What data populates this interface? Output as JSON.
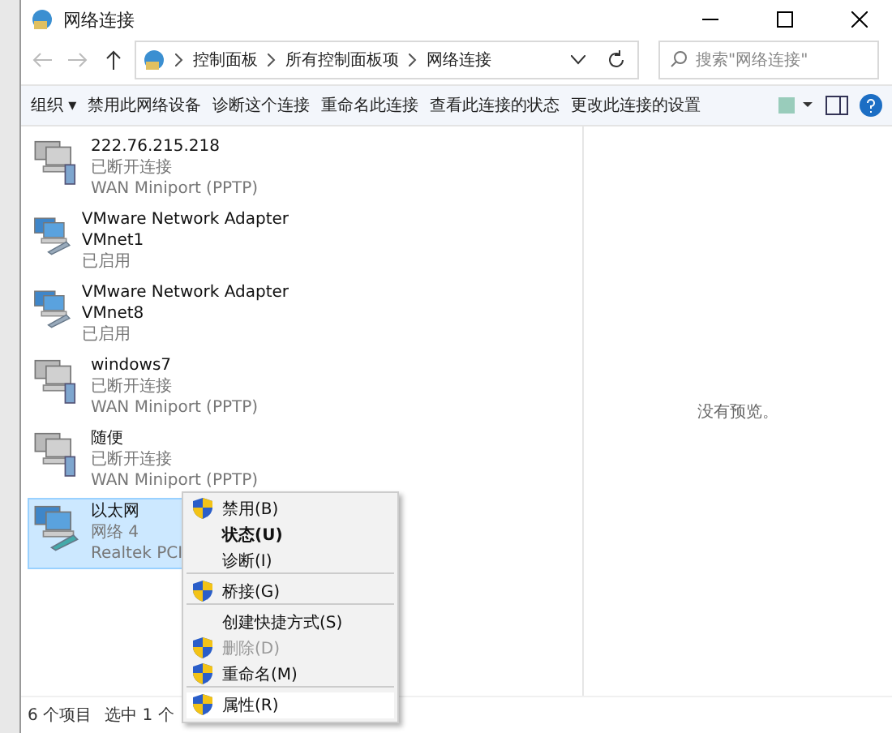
{
  "window": {
    "title": "网络连接"
  },
  "address": {
    "path": [
      {
        "label": "控制面板"
      },
      {
        "label": "所有控制面板项"
      },
      {
        "label": "网络连接"
      }
    ]
  },
  "search": {
    "placeholder": "搜索\"网络连接\""
  },
  "toolbar": {
    "organize": "组织 ▾",
    "commands": [
      "禁用此网络设备",
      "诊断这个连接",
      "重命名此连接",
      "查看此连接的状态",
      "更改此连接的设置"
    ]
  },
  "connections": [
    {
      "name": "222.76.215.218",
      "lines": [
        "已断开连接",
        "WAN Miniport (PPTP)"
      ],
      "kind": "wan",
      "selected": false
    },
    {
      "name": "VMware Network Adapter VMnet1",
      "lines": [
        "已启用"
      ],
      "kind": "adapter",
      "selected": false
    },
    {
      "name": "VMware Network Adapter VMnet8",
      "lines": [
        "已启用"
      ],
      "kind": "adapter",
      "selected": false
    },
    {
      "name": "windows7",
      "lines": [
        "已断开连接",
        "WAN Miniport (PPTP)"
      ],
      "kind": "wan",
      "selected": false
    },
    {
      "name": "随便",
      "lines": [
        "已断开连接",
        "WAN Miniport (PPTP)"
      ],
      "kind": "wan",
      "selected": false
    },
    {
      "name": "以太网",
      "lines": [
        "网络 4",
        "Realtek PCI"
      ],
      "kind": "adapter",
      "selected": true
    }
  ],
  "preview": {
    "text": "没有预览。"
  },
  "status_bar": {
    "count": "6 个项目",
    "selection": "选中 1 个"
  },
  "context_menu": [
    {
      "label": "禁用(B)",
      "shield": true,
      "default": false,
      "disabled": false,
      "selected": false,
      "separator_after": false
    },
    {
      "label": "状态(U)",
      "shield": false,
      "default": true,
      "disabled": false,
      "selected": false,
      "separator_after": false
    },
    {
      "label": "诊断(I)",
      "shield": false,
      "default": false,
      "disabled": false,
      "selected": false,
      "separator_after": true
    },
    {
      "label": "桥接(G)",
      "shield": true,
      "default": false,
      "disabled": false,
      "selected": false,
      "separator_after": true
    },
    {
      "label": "创建快捷方式(S)",
      "shield": false,
      "default": false,
      "disabled": false,
      "selected": false,
      "separator_after": false
    },
    {
      "label": "删除(D)",
      "shield": true,
      "default": false,
      "disabled": true,
      "selected": false,
      "separator_after": false
    },
    {
      "label": "重命名(M)",
      "shield": true,
      "default": false,
      "disabled": false,
      "selected": false,
      "separator_after": true
    },
    {
      "label": "属性(R)",
      "shield": true,
      "default": false,
      "disabled": false,
      "selected": true,
      "separator_after": false
    }
  ]
}
